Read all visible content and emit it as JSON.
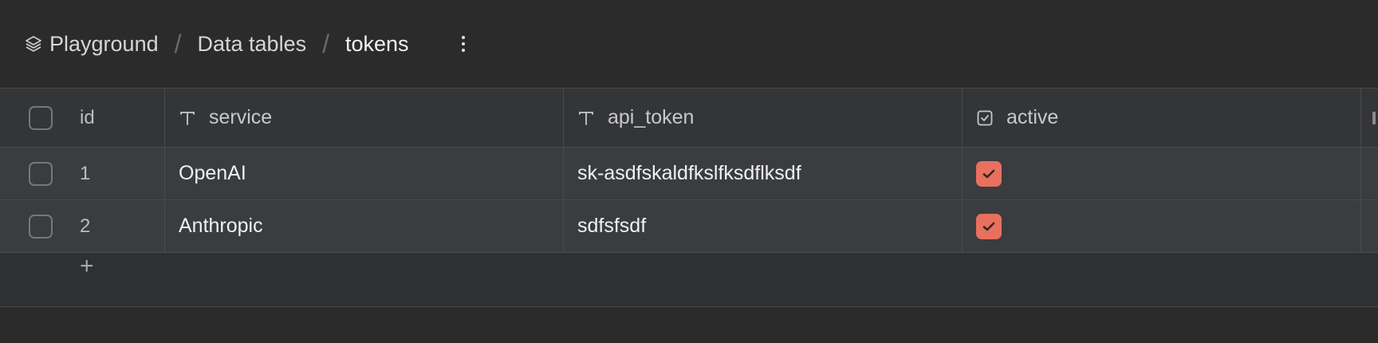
{
  "breadcrumb": {
    "items": [
      {
        "label": "Playground",
        "icon": "layers-icon"
      },
      {
        "label": "Data tables"
      },
      {
        "label": "tokens"
      }
    ],
    "separator": "/"
  },
  "table": {
    "columns": [
      {
        "key": "id",
        "label": "id"
      },
      {
        "key": "service",
        "label": "service",
        "type_icon": "text-type-icon"
      },
      {
        "key": "api_token",
        "label": "api_token",
        "type_icon": "text-type-icon"
      },
      {
        "key": "active",
        "label": "active",
        "type_icon": "boolean-type-icon"
      }
    ],
    "rows": [
      {
        "id": "1",
        "service": "OpenAI",
        "api_token": "sk-asdfskaldfkslfksdflksdf",
        "active": true
      },
      {
        "id": "2",
        "service": "Anthropic",
        "api_token": "sdfsfsdf",
        "active": true
      }
    ],
    "add_row_label": "+"
  },
  "colors": {
    "background": "#2b2b2b",
    "row_background": "#3a3c3f",
    "accent_checked": "#e8705e"
  }
}
